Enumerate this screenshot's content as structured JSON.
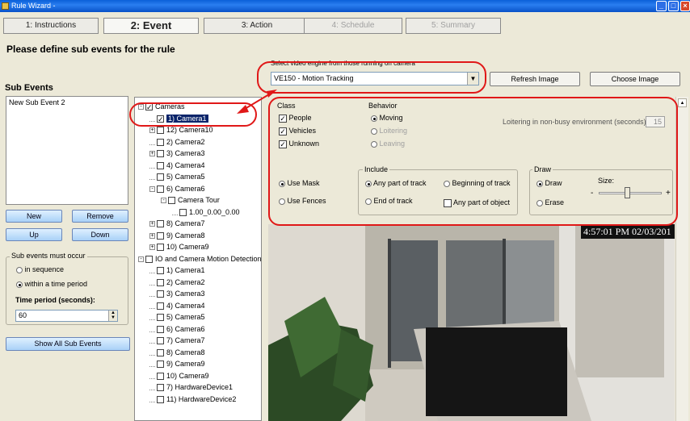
{
  "window": {
    "title": "Rule Wizard -"
  },
  "tabs": [
    {
      "label": "1: Instructions",
      "state": "normal"
    },
    {
      "label": "2: Event",
      "state": "active"
    },
    {
      "label": "3: Action",
      "state": "normal"
    },
    {
      "label": "4: Schedule",
      "state": "disabled"
    },
    {
      "label": "5: Summary",
      "state": "disabled"
    }
  ],
  "heading": "Please define sub events for the rule",
  "sub_events": {
    "label": "Sub Events",
    "items": [
      "New Sub Event 2"
    ],
    "buttons": {
      "new": "New",
      "remove": "Remove",
      "up": "Up",
      "down": "Down"
    },
    "occur": {
      "title": "Sub events must occur",
      "options": [
        "in sequence",
        "within a time period"
      ],
      "selected": 1,
      "time_label": "Time period (seconds):",
      "time_value": "60"
    },
    "show_all": "Show All Sub Events"
  },
  "tree": [
    {
      "label": "Cameras",
      "level": 0,
      "checked": true,
      "expand": "-"
    },
    {
      "label": "1) Camera1",
      "level": 1,
      "checked": true,
      "selected": true
    },
    {
      "label": "12) Camera10",
      "level": 1,
      "checked": false,
      "expand": "+"
    },
    {
      "label": "2) Camera2",
      "level": 1,
      "checked": false
    },
    {
      "label": "3) Camera3",
      "level": 1,
      "checked": false,
      "expand": "+"
    },
    {
      "label": "4) Camera4",
      "level": 1,
      "checked": false
    },
    {
      "label": "5) Camera5",
      "level": 1,
      "checked": false
    },
    {
      "label": "6) Camera6",
      "level": 1,
      "checked": false,
      "expand": "-"
    },
    {
      "label": "Camera Tour",
      "level": 2,
      "checked": false,
      "expand": "-"
    },
    {
      "label": "1.00_0.00_0.00",
      "level": 3,
      "checked": false
    },
    {
      "label": "8) Camera7",
      "level": 1,
      "checked": false,
      "expand": "+"
    },
    {
      "label": "9) Camera8",
      "level": 1,
      "checked": false,
      "expand": "+"
    },
    {
      "label": "10) Camera9",
      "level": 1,
      "checked": false,
      "expand": "+"
    },
    {
      "label": "IO and Camera Motion Detection",
      "level": 0,
      "checked": false,
      "expand": "-"
    },
    {
      "label": "1) Camera1",
      "level": 1,
      "checked": false
    },
    {
      "label": "2) Camera2",
      "level": 1,
      "checked": false
    },
    {
      "label": "3) Camera3",
      "level": 1,
      "checked": false
    },
    {
      "label": "4) Camera4",
      "level": 1,
      "checked": false
    },
    {
      "label": "5) Camera5",
      "level": 1,
      "checked": false
    },
    {
      "label": "6) Camera6",
      "level": 1,
      "checked": false
    },
    {
      "label": "7) Camera7",
      "level": 1,
      "checked": false
    },
    {
      "label": "8) Camera8",
      "level": 1,
      "checked": false
    },
    {
      "label": "9) Camera9",
      "level": 1,
      "checked": false
    },
    {
      "label": "10) Camera9",
      "level": 1,
      "checked": false
    },
    {
      "label": "7) HardwareDevice1",
      "level": 1,
      "checked": false
    },
    {
      "label": "11) HardwareDevice2",
      "level": 1,
      "checked": false
    }
  ],
  "engine": {
    "label": "Select video engine from those running on camera",
    "value": "VE150 - Motion Tracking",
    "refresh": "Refresh Image",
    "choose": "Choose Image"
  },
  "settings": {
    "class_title": "Class",
    "classes": [
      {
        "label": "People",
        "checked": true
      },
      {
        "label": "Vehicles",
        "checked": true
      },
      {
        "label": "Unknown",
        "checked": true
      }
    ],
    "behavior_title": "Behavior",
    "behaviors": [
      {
        "label": "Moving",
        "on": true,
        "enabled": true
      },
      {
        "label": "Loitering",
        "on": false,
        "enabled": false
      },
      {
        "label": "Leaving",
        "on": false,
        "enabled": false
      }
    ],
    "loiter_label": "Loitering in non-busy environment (seconds)",
    "loiter_value": "15",
    "mask": {
      "use_mask": "Use Mask",
      "use_fences": "Use Fences",
      "selected": "mask"
    },
    "include": {
      "title": "Include",
      "any_track": "Any part of track",
      "begin_track": "Beginning of track",
      "end_track": "End of track",
      "any_object": "Any part of object"
    },
    "draw": {
      "title": "Draw",
      "draw": "Draw",
      "erase": "Erase",
      "size_label": "Size:",
      "minus": "-",
      "plus": "+",
      "size_level": 0.45
    }
  },
  "video": {
    "timestamp": "4:57:01 PM 02/03/201"
  },
  "highlight_color": "#e01818"
}
